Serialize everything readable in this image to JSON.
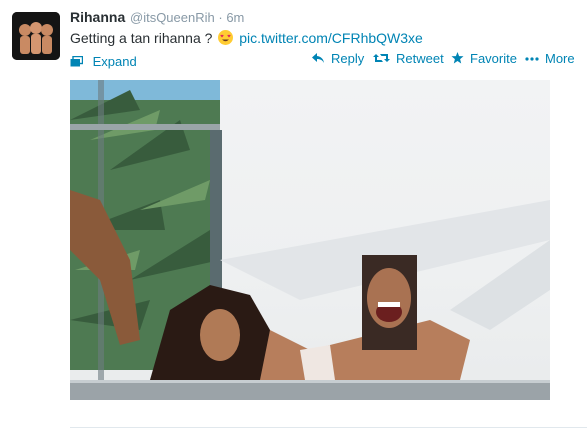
{
  "tweet": {
    "author_name": "Rihanna",
    "author_handle": "@itsQueenRih",
    "time": "· 6m",
    "text": "Getting a tan rihanna ?",
    "link": "pic.twitter.com/CFRhbQW3xe",
    "emoji": "smiling-face-with-heart-eyes-icon"
  },
  "media": {
    "expand_label": "Expand"
  },
  "actions": {
    "reply": "Reply",
    "retweet": "Retweet",
    "favorite": "Favorite",
    "more": "More"
  },
  "colors": {
    "link": "#0084b4",
    "text": "#292f33",
    "muted": "#8899a6",
    "divider": "#e1e8ed"
  }
}
